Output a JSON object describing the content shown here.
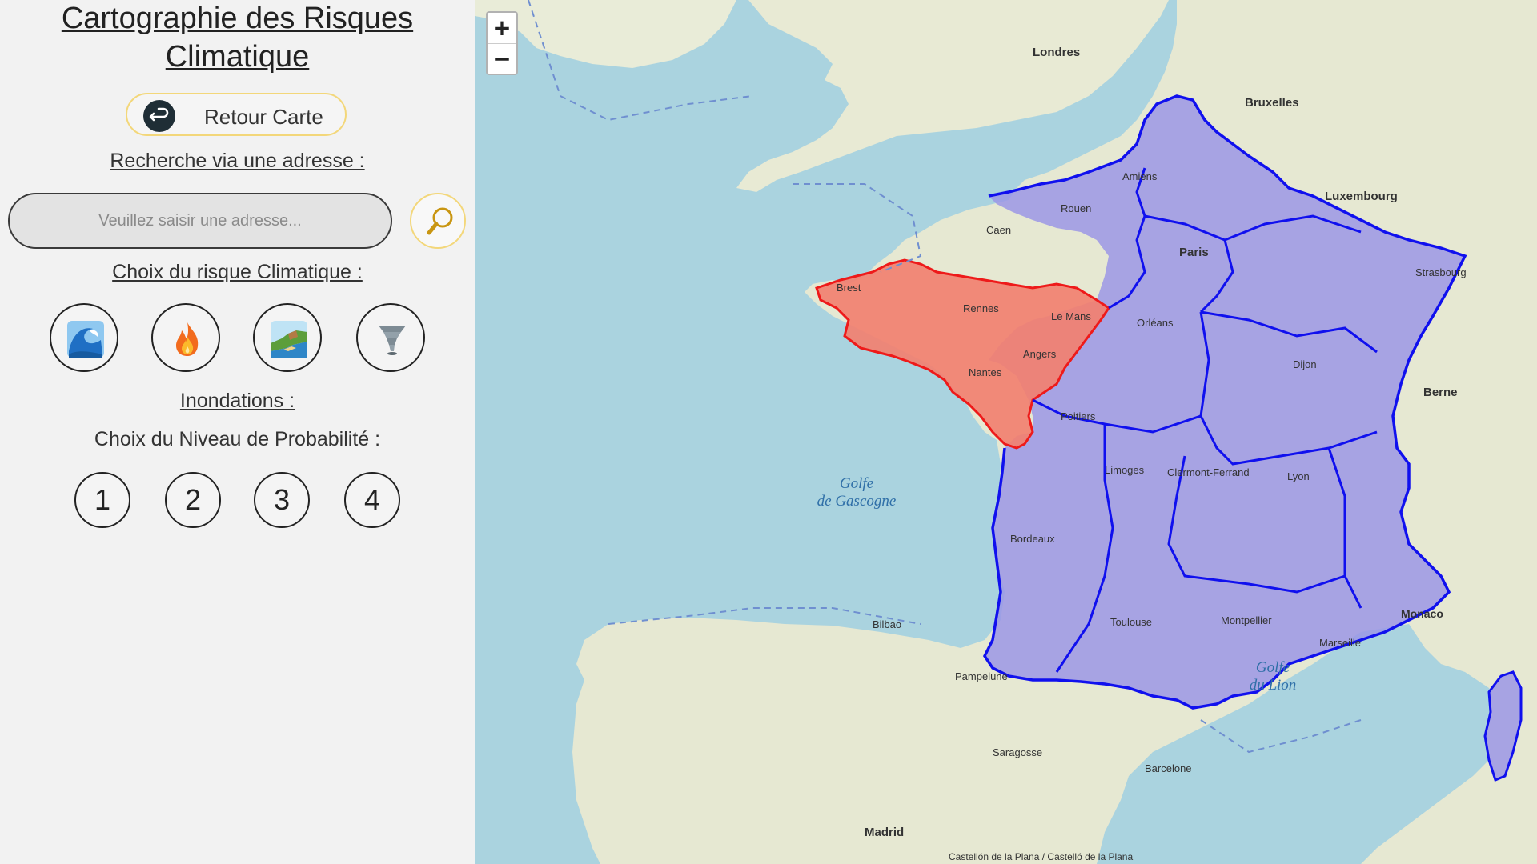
{
  "sidebar": {
    "title_line1": "Cartographie des Risques",
    "title_line2": "Climatique",
    "back_button": {
      "label": "Retour Carte",
      "icon": "arrow-return-icon"
    },
    "search_heading": "Recherche via une adresse :",
    "search_placeholder": "Veuillez saisir une adresse...",
    "search_icon": "magnifier-icon",
    "risk_heading": "Choix du risque Climatique :",
    "risk_options": [
      {
        "icon": "wave-icon"
      },
      {
        "icon": "fire-icon"
      },
      {
        "icon": "coast-erosion-icon"
      },
      {
        "icon": "tornado-icon"
      }
    ],
    "selected_risk_heading": "Inondations :",
    "probability_heading": "Choix du Niveau de Probabilité :",
    "probability_levels": [
      "1",
      "2",
      "3",
      "4"
    ]
  },
  "map": {
    "zoom_in": "+",
    "zoom_out": "−",
    "highlighted_region_color": "#f07a6a",
    "regions_color": "#9a95e8",
    "border_color": "#1010ee",
    "sea_labels": [
      "Golfe",
      "de Gascogne",
      "Golfe",
      "du Lion"
    ],
    "city_labels": [
      "Paris",
      "Londres",
      "Bruxelles",
      "Luxembourg",
      "Berne",
      "Madrid",
      "Monaco",
      "Nantes",
      "Rennes",
      "Le Mans",
      "Angers",
      "Bordeaux",
      "Toulouse",
      "Lyon",
      "Marseille",
      "Brest",
      "Orléans",
      "Limoges",
      "Dijon",
      "Strasbourg",
      "Montpellier",
      "Clermont-Ferrand",
      "Poitiers",
      "Amiens",
      "Rouen",
      "Caen",
      "Pampelune",
      "Barcelone",
      "Saragosse",
      "Bilbao"
    ],
    "attribution_partial": "Castellón de la Plana / Castelló de la Plana"
  }
}
